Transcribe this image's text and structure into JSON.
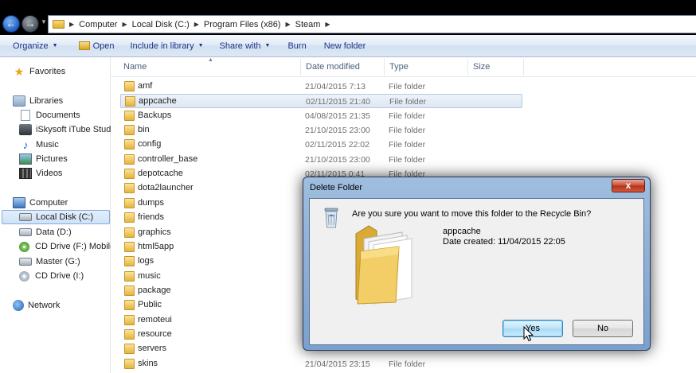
{
  "address_bar": {
    "crumbs": [
      "Computer",
      "Local Disk (C:)",
      "Program Files (x86)",
      "Steam"
    ]
  },
  "toolbar": {
    "organize": "Organize",
    "open": "Open",
    "include_in_library": "Include in library",
    "share_with": "Share with",
    "burn": "Burn",
    "new_folder": "New folder"
  },
  "nav": {
    "favorites": "Favorites",
    "libraries": "Libraries",
    "documents": "Documents",
    "iskysoft": "iSkysoft iTube Studio",
    "music": "Music",
    "pictures": "Pictures",
    "videos": "Videos",
    "computer": "Computer",
    "local_disk": "Local Disk (C:)",
    "data": "Data (D:)",
    "cd_drive_f": "CD Drive (F:) Mobile",
    "master": "Master (G:)",
    "cd_drive_i": "CD Drive (I:)",
    "network": "Network"
  },
  "columns": {
    "name": "Name",
    "date_modified": "Date modified",
    "type": "Type",
    "size": "Size"
  },
  "files": [
    {
      "name": "amf",
      "date": "21/04/2015 7:13",
      "type": "File folder"
    },
    {
      "name": "appcache",
      "date": "02/11/2015 21:40",
      "type": "File folder"
    },
    {
      "name": "Backups",
      "date": "04/08/2015 21:35",
      "type": "File folder"
    },
    {
      "name": "bin",
      "date": "21/10/2015 23:00",
      "type": "File folder"
    },
    {
      "name": "config",
      "date": "02/11/2015 22:02",
      "type": "File folder"
    },
    {
      "name": "controller_base",
      "date": "21/10/2015 23:00",
      "type": "File folder"
    },
    {
      "name": "depotcache",
      "date": "02/11/2015 0:41",
      "type": "File folder"
    },
    {
      "name": "dota2launcher",
      "date": "",
      "type": ""
    },
    {
      "name": "dumps",
      "date": "",
      "type": ""
    },
    {
      "name": "friends",
      "date": "",
      "type": ""
    },
    {
      "name": "graphics",
      "date": "",
      "type": ""
    },
    {
      "name": "html5app",
      "date": "",
      "type": ""
    },
    {
      "name": "logs",
      "date": "",
      "type": ""
    },
    {
      "name": "music",
      "date": "",
      "type": ""
    },
    {
      "name": "package",
      "date": "",
      "type": ""
    },
    {
      "name": "Public",
      "date": "",
      "type": ""
    },
    {
      "name": "remoteui",
      "date": "",
      "type": ""
    },
    {
      "name": "resource",
      "date": "",
      "type": ""
    },
    {
      "name": "servers",
      "date": "",
      "type": ""
    },
    {
      "name": "skins",
      "date": "21/04/2015 23:15",
      "type": "File folder"
    }
  ],
  "dialog": {
    "title": "Delete Folder",
    "close": "x",
    "question": "Are you sure you want to move this folder to the Recycle Bin?",
    "item_name": "appcache",
    "item_date": "Date created: 11/04/2015 22:05",
    "yes": "Yes",
    "no": "No"
  }
}
